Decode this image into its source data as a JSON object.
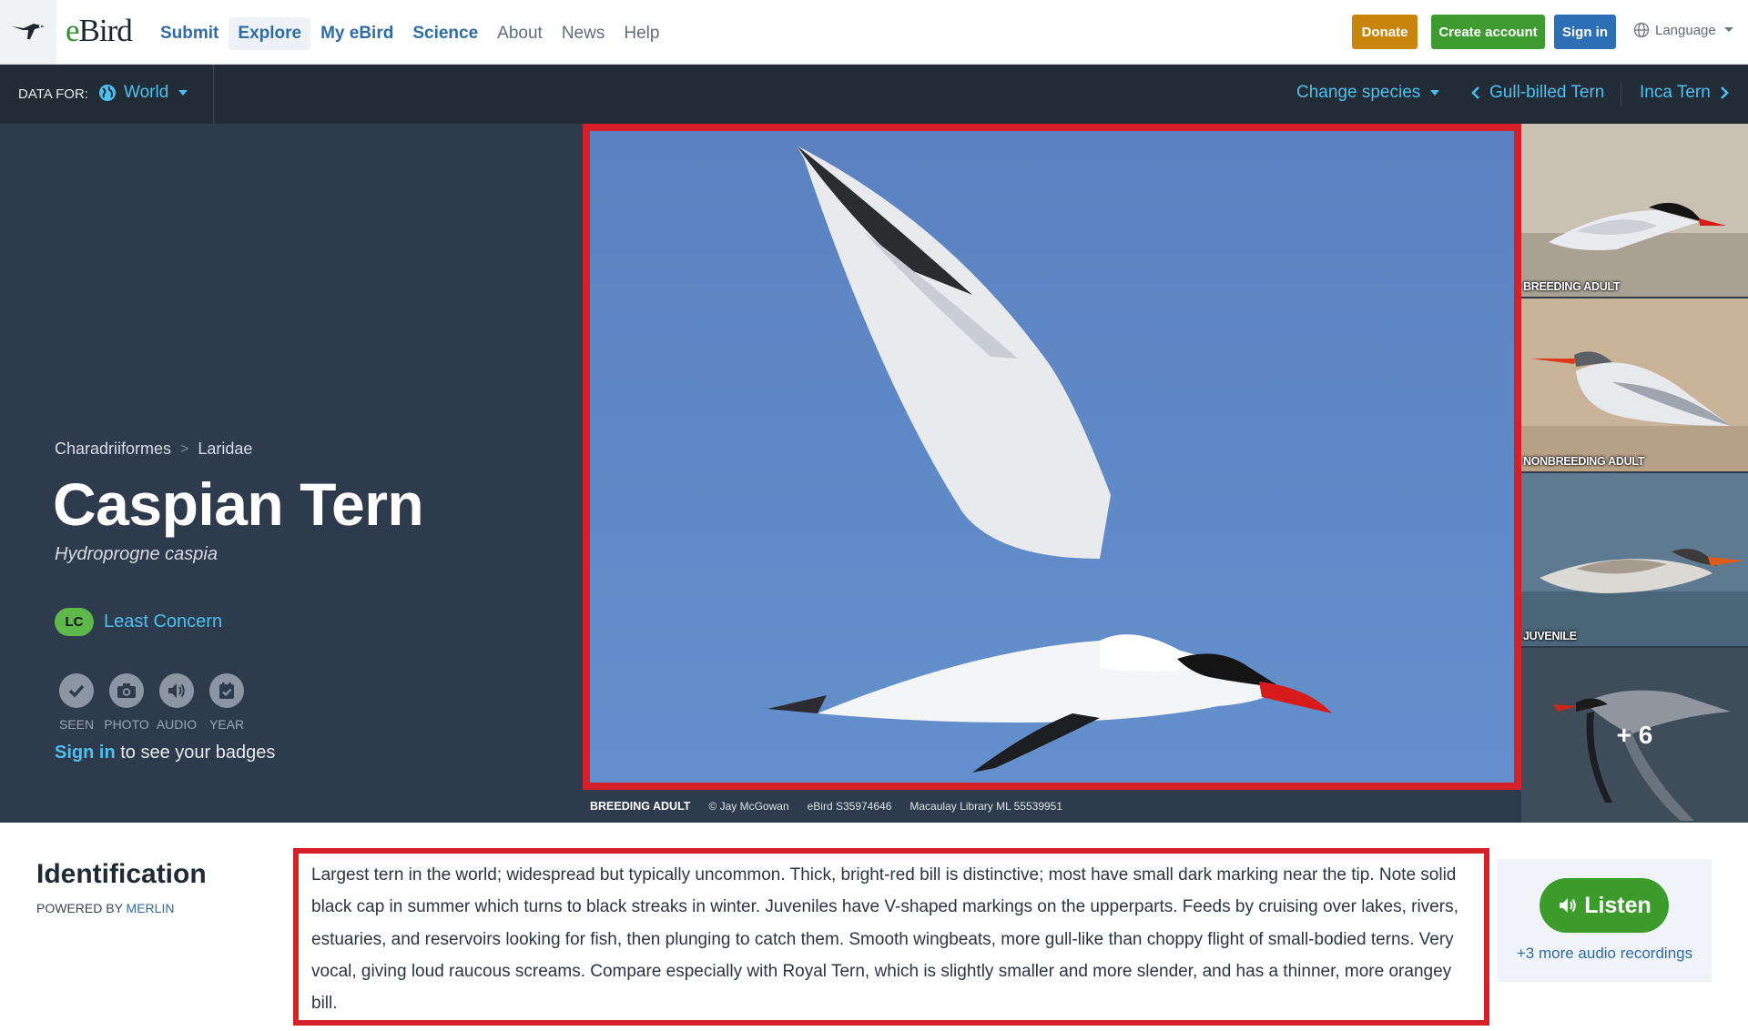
{
  "brand": "eBird",
  "nav": {
    "items": [
      {
        "label": "Submit",
        "style": "bold"
      },
      {
        "label": "Explore",
        "style": "bold-active"
      },
      {
        "label": "My eBird",
        "style": "bold"
      },
      {
        "label": "Science",
        "style": "bold"
      },
      {
        "label": "About",
        "style": "normal"
      },
      {
        "label": "News",
        "style": "normal"
      },
      {
        "label": "Help",
        "style": "normal"
      }
    ],
    "donate": "Donate",
    "create_account": "Create account",
    "sign_in": "Sign in",
    "language": "Language"
  },
  "databar": {
    "label": "DATA FOR:",
    "region": "World",
    "change_species": "Change species",
    "prev_species": "Gull-billed Tern",
    "next_species": "Inca Tern"
  },
  "species": {
    "order": "Charadriiformes",
    "family": "Laridae",
    "common_name": "Caspian Tern",
    "scientific_name": "Hydroprogne caspia",
    "status_code": "LC",
    "status_label": "Least Concern",
    "badges": [
      "SEEN",
      "PHOTO",
      "AUDIO",
      "YEAR"
    ],
    "signin_link": "Sign in",
    "signin_rest": "to see your badges"
  },
  "photo": {
    "caption": "BREEDING ADULT",
    "credit": "© Jay McGowan",
    "checklist": "eBird S35974646",
    "library": "Macaulay Library ML 55539951"
  },
  "thumbnails": [
    {
      "label": "BREEDING ADULT"
    },
    {
      "label": "NONBREEDING ADULT"
    },
    {
      "label": "JUVENILE"
    },
    {
      "label": "+ 6"
    }
  ],
  "identification": {
    "title": "Identification",
    "powered_by": "POWERED BY",
    "merlin": "MERLIN",
    "text": "Largest tern in the world; widespread but typically uncommon. Thick, bright-red bill is distinctive; most have small dark marking near the tip. Note solid black cap in summer which turns to black streaks in winter. Juveniles have V-shaped markings on the upperparts. Feeds by cruising over lakes, rivers, estuaries, and reservoirs looking for fish, then plunging to catch them. Smooth wingbeats, more gull-like than choppy flight of small-bodied terns. Very vocal, giving loud raucous screams. Compare especially with Royal Tern, which is slightly smaller and more slender, and has a thinner, more orangey bill.",
    "listen": "Listen",
    "more_audio": "+3 more audio recordings"
  },
  "colors": {
    "hero_bg": "#2d3b4c",
    "databar_bg": "#222c36",
    "link_blue": "#4ec0ef",
    "highlight_red": "#d51f29",
    "listen_green": "#3b9b2b",
    "sky_blue": "#5c87c2"
  }
}
